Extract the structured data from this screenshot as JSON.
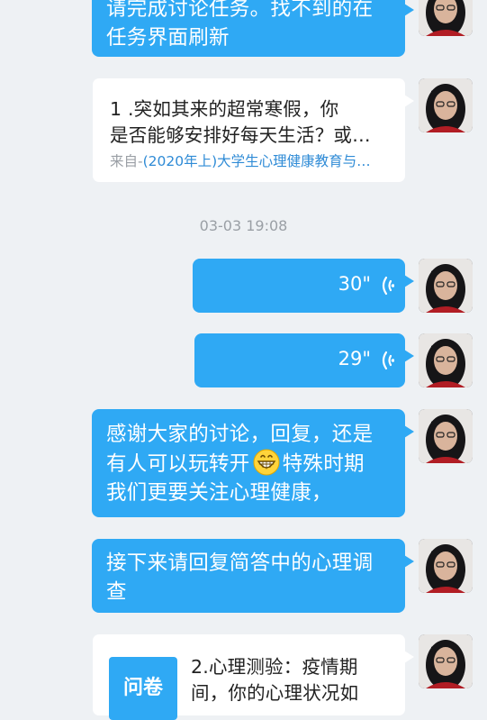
{
  "messages": {
    "m1": {
      "line1": "请完成讨论任务。找不到的在",
      "line2": "任务界面刷新"
    },
    "m2": {
      "line1": "1 .突如其来的超常寒假，你",
      "line2": "是否能够安排好每天生活？或…",
      "source_prefix": "来自-",
      "source_link": "(2020年上)大学生心理健康教育与…"
    },
    "timestamp": "03-03 19:08",
    "voice1": {
      "duration": "30\""
    },
    "voice2": {
      "duration": "29\""
    },
    "m5": {
      "line1": "感谢大家的讨论，回复，还是",
      "line2_a": "有人可以玩转开",
      "line2_b": "特殊时期",
      "line3": "我们更要关注心理健康，",
      "emoji": "grinning-face-emoji"
    },
    "m6": {
      "line1": "接下来请回复简答中的心理调",
      "line2": "查"
    },
    "m7": {
      "badge": "问卷",
      "line1": "2.心理测验：疫情期",
      "line2": "间，你的心理状况如"
    }
  },
  "colors": {
    "background": "#eef1f4",
    "bubble": "#2fa9f4",
    "card": "#ffffff",
    "link": "#2f8bd6",
    "timestamp": "#9a9fa5",
    "badge": "#2fa9f4"
  },
  "icons": {
    "voice": "voice-wave-icon",
    "avatar": "user-avatar"
  }
}
